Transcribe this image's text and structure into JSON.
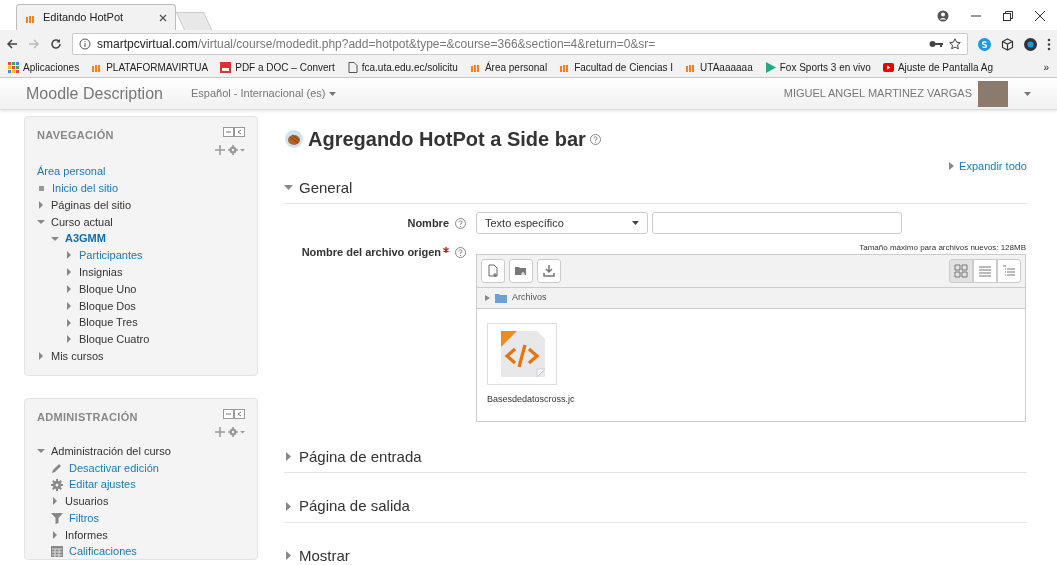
{
  "browser": {
    "tab_title": "Editando HotPot",
    "url_host": "smartpcvirtual.com",
    "url_path": "/virtual/course/modedit.php?add=hotpot&type=&course=366&section=4&return=0&sr=",
    "bookmarks": [
      {
        "label": "Aplicaciones",
        "kind": "apps"
      },
      {
        "label": "PLATAFORMAVIRTUA",
        "kind": "moodle"
      },
      {
        "label": "PDF a DOC – Convert",
        "kind": "pdf"
      },
      {
        "label": "fca.uta.edu.ec/solicitu",
        "kind": "page"
      },
      {
        "label": "Área personal",
        "kind": "moodle"
      },
      {
        "label": "Facultad de Ciencias I",
        "kind": "moodle"
      },
      {
        "label": "UTAaaaaaa",
        "kind": "moodle"
      },
      {
        "label": "Fox Sports 3 en vivo",
        "kind": "play"
      },
      {
        "label": "Ajuste de Pantalla Ag",
        "kind": "video"
      }
    ],
    "more": "»"
  },
  "navbar": {
    "brand": "Moodle Description",
    "language": "Español - Internacional (es)",
    "user_name": "MIGUEL ANGEL MARTINEZ VARGAS"
  },
  "navigation": {
    "title": "NAVEGACIÓN",
    "items": [
      {
        "label": "Área personal",
        "link": true
      },
      {
        "label": "Inicio del sitio",
        "link": true,
        "kind": "bullet"
      },
      {
        "label": "Páginas del sitio",
        "link": false,
        "kind": "folder",
        "expanded": false
      },
      {
        "label": "Curso actual",
        "link": false,
        "kind": "folder",
        "expanded": true,
        "children": [
          {
            "label": "A3GMM",
            "link": true,
            "current": true,
            "kind": "folder",
            "expanded": true,
            "children": [
              {
                "label": "Participantes",
                "link": true,
                "kind": "folder",
                "expanded": false
              },
              {
                "label": "Insignias",
                "link": false,
                "kind": "folder",
                "expanded": false
              },
              {
                "label": "Bloque Uno",
                "link": false,
                "kind": "folder",
                "expanded": false
              },
              {
                "label": "Bloque Dos",
                "link": false,
                "kind": "folder",
                "expanded": false
              },
              {
                "label": "Bloque Tres",
                "link": false,
                "kind": "folder",
                "expanded": false
              },
              {
                "label": "Bloque Cuatro",
                "link": false,
                "kind": "folder",
                "expanded": false
              }
            ]
          }
        ]
      },
      {
        "label": "Mis cursos",
        "link": false,
        "kind": "folder",
        "expanded": false
      }
    ]
  },
  "administration": {
    "title": "ADMINISTRACIÓN",
    "items": [
      {
        "label": "Administración del curso",
        "link": false,
        "kind": "folder",
        "expanded": true,
        "children": [
          {
            "label": "Desactivar edición",
            "link": true,
            "kind": "pencil"
          },
          {
            "label": "Editar ajustes",
            "link": true,
            "kind": "gear"
          },
          {
            "label": "Usuarios",
            "link": false,
            "kind": "folder",
            "expanded": false
          },
          {
            "label": "Filtros",
            "link": true,
            "kind": "filter"
          },
          {
            "label": "Informes",
            "link": false,
            "kind": "folder",
            "expanded": false
          },
          {
            "label": "Calificaciones",
            "link": true,
            "kind": "table"
          }
        ]
      }
    ]
  },
  "main": {
    "title": "Agregando HotPot a Side bar",
    "expand_all": "Expandir todo",
    "sections": [
      {
        "title": "General",
        "expanded": true
      },
      {
        "title": "Página de entrada",
        "expanded": false
      },
      {
        "title": "Página de salida",
        "expanded": false
      },
      {
        "title": "Mostrar",
        "expanded": false
      }
    ],
    "name_field": {
      "label": "Nombre",
      "select_value": "Texto específico"
    },
    "file_field": {
      "label": "Nombre del archivo origen",
      "required": true,
      "max_size": "Tamaño máximo para archivos nuevos: 128MB",
      "views": [
        {
          "kind": "icons",
          "selected": true
        },
        {
          "kind": "list",
          "selected": false
        },
        {
          "kind": "tree",
          "selected": false
        }
      ],
      "path": "Archivos",
      "files": [
        {
          "name": "Basesdedatoscross.jc"
        }
      ]
    }
  }
}
